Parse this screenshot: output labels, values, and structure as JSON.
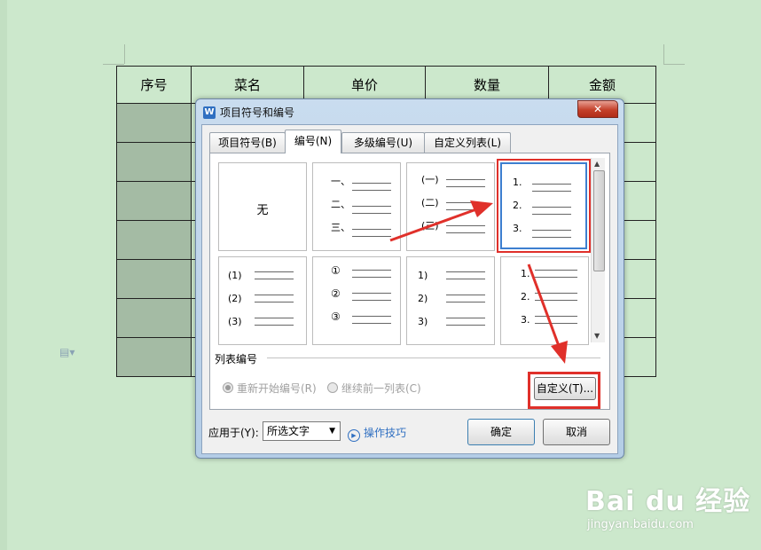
{
  "document": {
    "table_headers": [
      "序号",
      "菜名",
      "单价",
      "数量",
      "金额"
    ],
    "row_count": 7
  },
  "dialog": {
    "title": "项目符号和编号",
    "title_icon": "W",
    "close_icon": "close-icon",
    "tabs": [
      {
        "label": "项目符号(B)",
        "active": false
      },
      {
        "label": "编号(N)",
        "active": true
      },
      {
        "label": "多级编号(U)",
        "active": false
      },
      {
        "label": "自定义列表(L)",
        "active": false
      }
    ],
    "gallery": [
      {
        "id": "none",
        "text": "无"
      },
      {
        "id": "chinese-comma",
        "labels": [
          "一、",
          "二、",
          "三、"
        ]
      },
      {
        "id": "chinese-paren",
        "labels": [
          "(一)",
          "(二)",
          "(三)"
        ]
      },
      {
        "id": "arabic-dot",
        "labels": [
          "1.",
          "2.",
          "3."
        ],
        "selected": true
      },
      {
        "id": "arabic-paren",
        "labels": [
          "(1)",
          "(2)",
          "(3)"
        ]
      },
      {
        "id": "circled",
        "labels": [
          "①",
          "②",
          "③"
        ]
      },
      {
        "id": "arabic-halfparen",
        "labels": [
          "1)",
          "2)",
          "3)"
        ]
      },
      {
        "id": "arabic-dot-2",
        "labels": [
          "1.",
          "2.",
          "3."
        ]
      }
    ],
    "list_numbering_label": "列表编号",
    "restart_label": "重新开始编号(R)",
    "continue_label": "继续前一列表(C)",
    "customize_label": "自定义(T)...",
    "apply_to_label": "应用于(Y):",
    "apply_to_value": "所选文字",
    "tips_label": "操作技巧",
    "ok_label": "确定",
    "cancel_label": "取消"
  },
  "watermark": {
    "brand": "Bai du 经验",
    "url": "jingyan.baidu.com"
  },
  "colors": {
    "background": "#cce8cc",
    "shaded_cell": "#a4bba4",
    "annotation_red": "#e0302a",
    "dialog_frame": "#b4cde6"
  }
}
